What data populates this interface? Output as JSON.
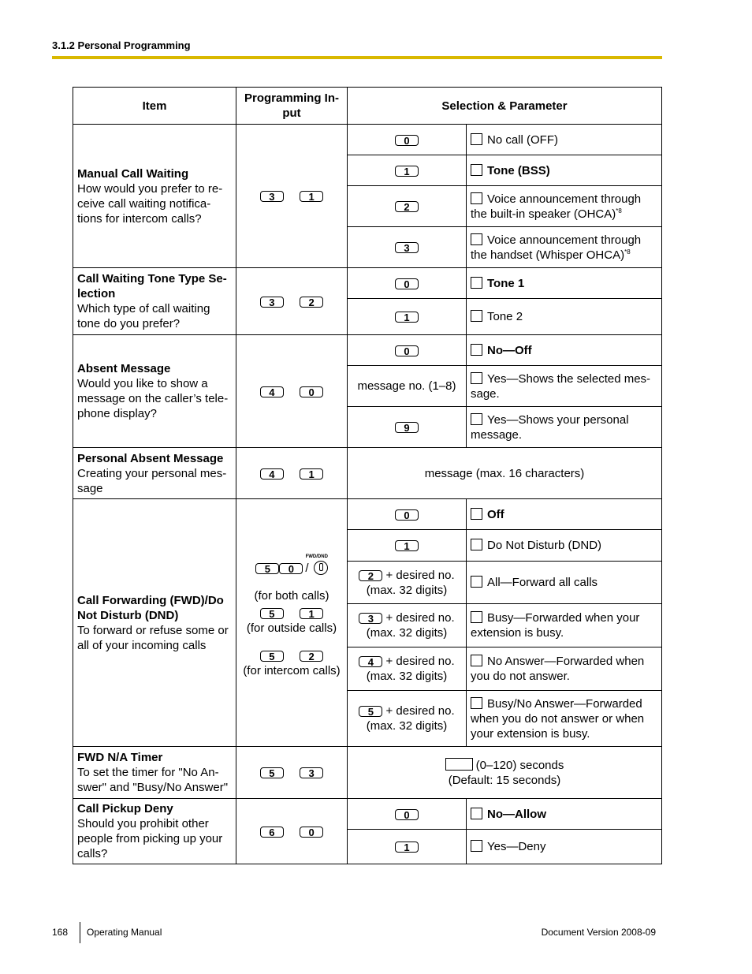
{
  "header": {
    "section_title": "3.1.2 Personal Programming",
    "rule_color": "#D9B800"
  },
  "table": {
    "columns": [
      "Item",
      "Programming In-\nput",
      "Selection & Parameter"
    ],
    "col_item": "Item",
    "col_input": "Programming In-put",
    "col_selection": "Selection & Parameter",
    "rows": {
      "manual_call_waiting": {
        "title": "Manual Call Waiting",
        "desc": "How would you prefer to receive call waiting notifications for intercom calls?",
        "input_keys": [
          "3",
          "1"
        ],
        "options": [
          {
            "key": "0",
            "label": "No call (OFF)",
            "default": false
          },
          {
            "key": "1",
            "label": "Tone (BSS)",
            "default": true
          },
          {
            "key": "2",
            "label": "Voice announcement through the built-in speaker (OHCA)",
            "footnote": "*8",
            "default": false
          },
          {
            "key": "3",
            "label": "Voice announcement through the handset (Whisper OHCA)",
            "footnote": "*8",
            "default": false
          }
        ]
      },
      "tone_type": {
        "title": "Call Waiting Tone Type Selection",
        "desc": "Which type of call waiting tone do you prefer?",
        "input_keys": [
          "3",
          "2"
        ],
        "options": [
          {
            "key": "0",
            "label": "Tone 1",
            "default": true
          },
          {
            "key": "1",
            "label": "Tone 2",
            "default": false
          }
        ]
      },
      "absent_message": {
        "title": "Absent Message",
        "desc": "Would you like to show a message on the caller’s telephone display?",
        "input_keys": [
          "4",
          "0"
        ],
        "options": [
          {
            "key": "0",
            "label": "No—Off",
            "default": true
          },
          {
            "param": "message no. (1–8)",
            "label": "Yes—Shows the selected message.",
            "default": false
          },
          {
            "key": "9",
            "label": "Yes—Shows your personal message.",
            "default": false
          }
        ]
      },
      "personal_absent_message": {
        "title": "Personal Absent Message",
        "desc": "Creating your personal message",
        "input_keys": [
          "4",
          "1"
        ],
        "parameter": "message (max. 16 characters)"
      },
      "call_forwarding": {
        "title": "Call Forwarding (FWD)/Do Not Disturb (DND)",
        "desc": "To forward or refuse some or all of your incoming calls",
        "both_keys": [
          "5",
          "0"
        ],
        "separator": "/",
        "fwd_button_label": "FWD/DND",
        "both_note": "(for both calls)",
        "outside_keys": [
          "5",
          "1"
        ],
        "outside_note": "(for outside calls)",
        "intercom_keys": [
          "5",
          "2"
        ],
        "intercom_note": "(for intercom calls)",
        "desired_suffix": "+ desired no.",
        "max_digits": "(max. 32 digits)",
        "options": [
          {
            "key": "0",
            "label": "Off",
            "default": true
          },
          {
            "key": "1",
            "label": "Do Not Disturb (DND)",
            "default": false
          },
          {
            "key": "2",
            "label": "All—Forward all calls",
            "default": false
          },
          {
            "key": "3",
            "label": "Busy—Forwarded when your extension is busy.",
            "default": false
          },
          {
            "key": "4",
            "label": "No Answer—Forwarded when you do not answer.",
            "default": false
          },
          {
            "key": "5",
            "label": "Busy/No Answer—Forwarded when you do not answer or when your extension is busy.",
            "default": false
          }
        ]
      },
      "fwd_timer": {
        "title": "FWD N/A Timer",
        "desc": "To set the timer for \"No Answer\" and \"Busy/No Answer\"",
        "input_keys": [
          "5",
          "3"
        ],
        "range": "(0–120) seconds",
        "default_text": "(Default: 15 seconds)"
      },
      "pickup_deny": {
        "title": "Call Pickup Deny",
        "desc": "Should you prohibit other people from picking up your calls?",
        "input_keys": [
          "6",
          "0"
        ],
        "options": [
          {
            "key": "0",
            "label": "No—Allow",
            "default": true
          },
          {
            "key": "1",
            "label": "Yes—Deny",
            "default": false
          }
        ]
      }
    }
  },
  "footer": {
    "page_number": "168",
    "manual": "Operating Manual",
    "version": "Document Version  2008-09"
  }
}
